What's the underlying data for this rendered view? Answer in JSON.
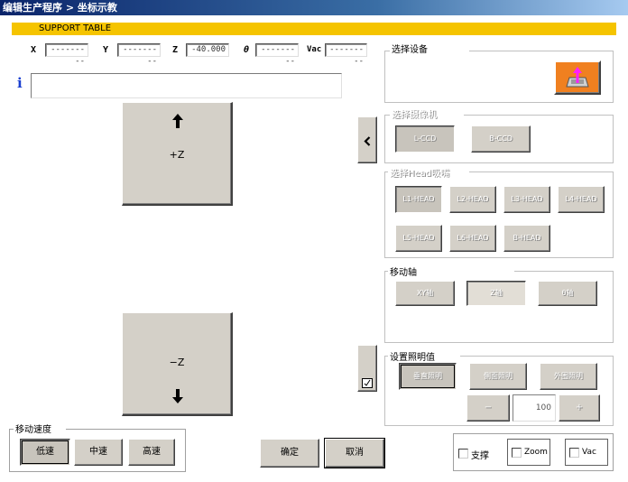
{
  "window": {
    "title": "编辑生产程序 > 坐标示教"
  },
  "banner": {
    "label": "SUPPORT TABLE"
  },
  "coords": [
    {
      "axis": "X",
      "value": "---------"
    },
    {
      "axis": "Y",
      "value": "---------"
    },
    {
      "axis": "Z",
      "value": "-40.000"
    },
    {
      "axis": "θ",
      "value": "---------"
    },
    {
      "axis": "Vac",
      "value": "---------"
    }
  ],
  "info": {
    "icon": "info-icon",
    "text": ""
  },
  "jog": {
    "up_label": "+Z",
    "down_label": "−Z"
  },
  "speed": {
    "title": "移动速度",
    "low": "低速",
    "mid": "中速",
    "high": "高速",
    "selected": "低速"
  },
  "actions": {
    "ok": "确定",
    "cancel": "取消"
  },
  "device": {
    "title": "选择设备"
  },
  "camera": {
    "title": "选择摄像机",
    "items": [
      "L-CCD",
      "B-CCD"
    ]
  },
  "heads": {
    "title": "选择Head吸嘴",
    "items": [
      "L1-HEAD",
      "L2-HEAD",
      "L3-HEAD",
      "L4-HEAD",
      "L5-HEAD",
      "L6-HEAD",
      "B-HEAD"
    ]
  },
  "axes": {
    "title": "移动轴",
    "items": [
      "XY轴",
      "Z轴",
      "θ轴"
    ],
    "selected": "Z轴"
  },
  "lighting": {
    "title": "设置照明值",
    "items": [
      "垂直照明",
      "侧面照明",
      "外围照明"
    ],
    "minus": "−",
    "value": "100",
    "plus": "+"
  },
  "checks": {
    "support": "支撑",
    "zoom": "Zoom",
    "vac": "Vac"
  },
  "colors": {
    "banner": "#f5c400",
    "face": "#d4d0c8",
    "device_button": "#f08020"
  }
}
